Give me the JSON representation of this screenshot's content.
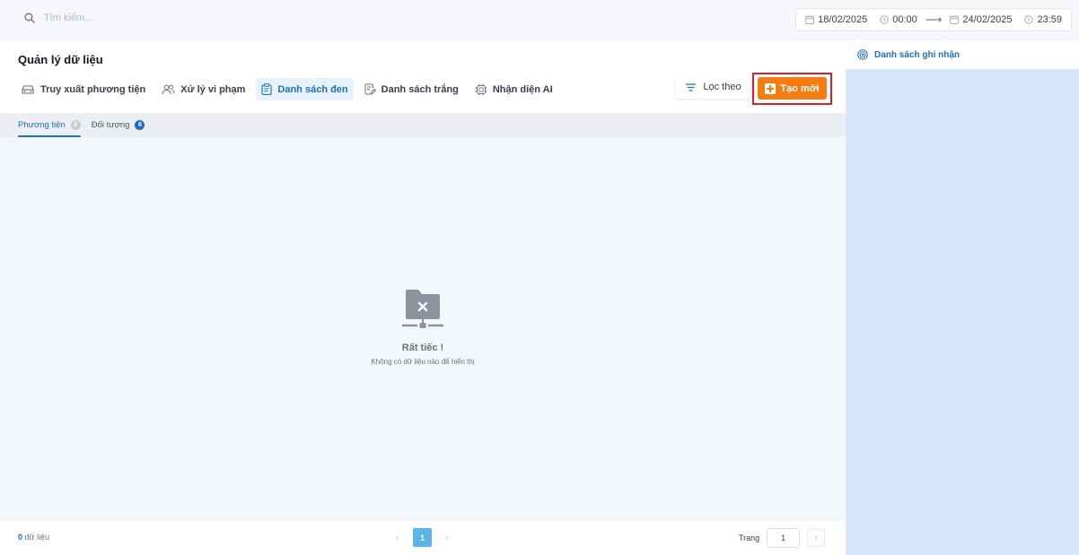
{
  "search": {
    "placeholder": "Tìm kiếm..."
  },
  "date_range": {
    "start_date": "18/02/2025",
    "start_time": "00:00",
    "separator": "⟶",
    "end_date": "24/02/2025",
    "end_time": "23:59"
  },
  "page": {
    "title": "Quản lý dữ liệu"
  },
  "nav": {
    "items": [
      {
        "label": "Truy xuất phương tiện",
        "icon": "car-icon"
      },
      {
        "label": "Xử lý vi phạm",
        "icon": "users-icon"
      },
      {
        "label": "Danh sách đen",
        "icon": "clipboard-icon"
      },
      {
        "label": "Danh sách trắng",
        "icon": "document-edit-icon"
      },
      {
        "label": "Nhận diện AI",
        "icon": "ai-chip-icon"
      }
    ],
    "active_index": 2
  },
  "toolbar": {
    "filter_label": "Lọc theo",
    "create_label": "Tạo mới"
  },
  "subtabs": [
    {
      "label": "Phương tiện",
      "count": "0"
    },
    {
      "label": "Đối tượng",
      "count": "6"
    }
  ],
  "empty_state": {
    "title": "Rất tiếc !",
    "description": "Không có dữ liệu nào để hiển thị"
  },
  "footer": {
    "count": "0",
    "count_label": "dữ liệu",
    "current_page": "1",
    "goto_label": "Trang",
    "goto_value": "1"
  },
  "right_panel": {
    "title": "Danh sách ghi nhận"
  },
  "colors": {
    "accent": "#1a6fc4",
    "create_button": "#f47d11",
    "highlight_box": "#e11d2a",
    "right_panel_bg": "#d6e7fd"
  }
}
